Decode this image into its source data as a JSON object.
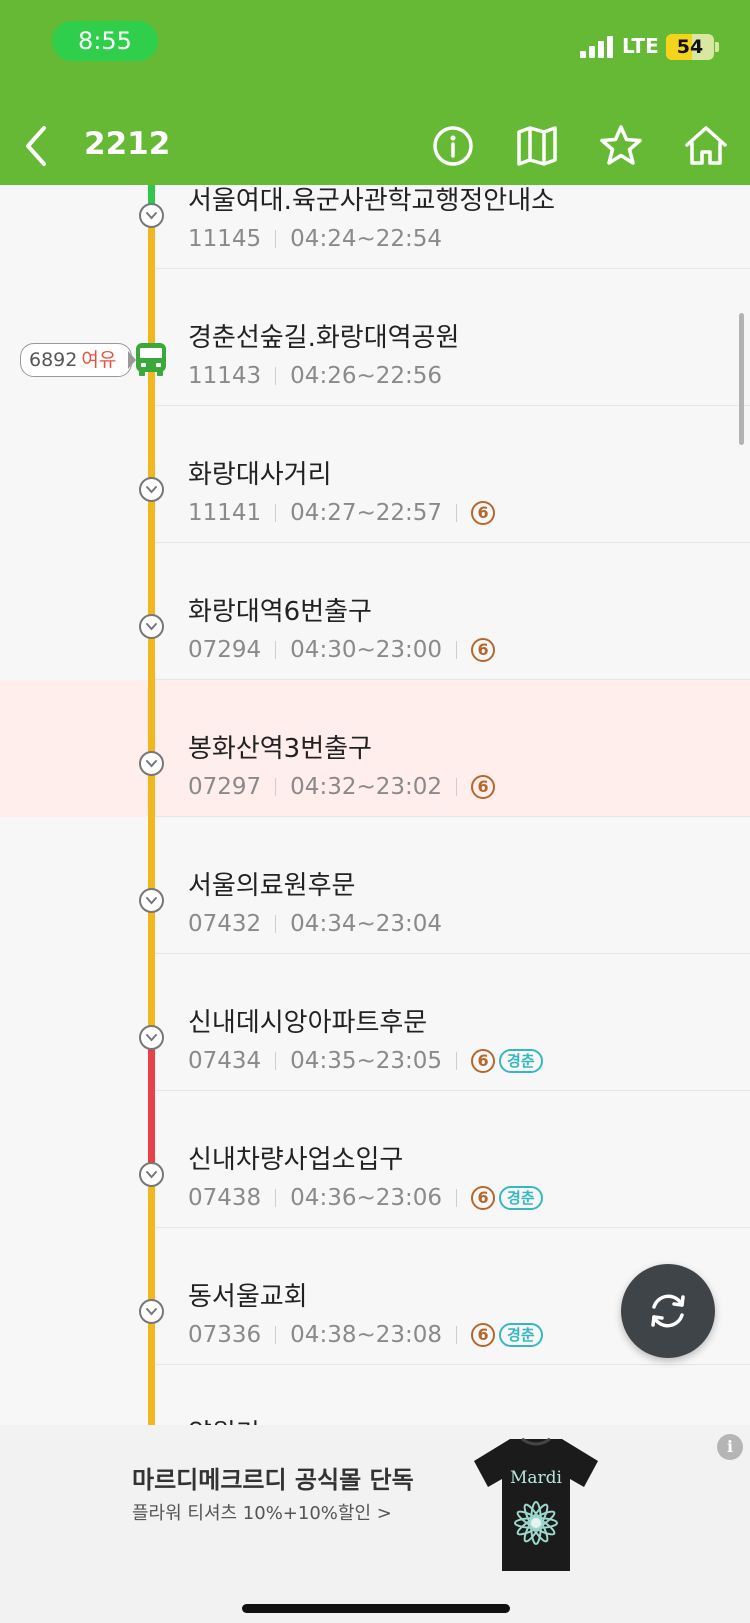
{
  "status_bar": {
    "time": "8:55",
    "network": "LTE",
    "battery": "54",
    "battery_level": 0.54
  },
  "header": {
    "route_number": "2212"
  },
  "bus": {
    "plate": "6892",
    "congestion": "여유"
  },
  "stops": [
    {
      "name": "서울여대.육군사관학교행정안내소",
      "id": "11145",
      "hours": "04:24~22:54",
      "subway": null,
      "gyeongchun": false,
      "highlight": false
    },
    {
      "name": "경춘선숲길.화랑대역공원",
      "id": "11143",
      "hours": "04:26~22:56",
      "subway": null,
      "gyeongchun": false,
      "highlight": false
    },
    {
      "name": "화랑대사거리",
      "id": "11141",
      "hours": "04:27~22:57",
      "subway": "6",
      "gyeongchun": false,
      "highlight": false
    },
    {
      "name": "화랑대역6번출구",
      "id": "07294",
      "hours": "04:30~23:00",
      "subway": "6",
      "gyeongchun": false,
      "highlight": false
    },
    {
      "name": "봉화산역3번출구",
      "id": "07297",
      "hours": "04:32~23:02",
      "subway": "6",
      "gyeongchun": false,
      "highlight": true
    },
    {
      "name": "서울의료원후문",
      "id": "07432",
      "hours": "04:34~23:04",
      "subway": null,
      "gyeongchun": false,
      "highlight": false
    },
    {
      "name": "신내데시앙아파트후문",
      "id": "07434",
      "hours": "04:35~23:05",
      "subway": "6",
      "gyeongchun": true,
      "highlight": false
    },
    {
      "name": "신내차량사업소입구",
      "id": "07438",
      "hours": "04:36~23:06",
      "subway": "6",
      "gyeongchun": true,
      "highlight": false
    },
    {
      "name": "동서울교회",
      "id": "07336",
      "hours": "04:38~23:08",
      "subway": "6",
      "gyeongchun": true,
      "highlight": false
    },
    {
      "name": "양원리",
      "id": "",
      "hours": "",
      "subway": null,
      "gyeongchun": false,
      "highlight": false
    }
  ],
  "gyeongchun_label": "경춘",
  "traffic_colors": {
    "smooth": "#2fc84a",
    "slow": "#f2b71f",
    "congested": "#e8414a"
  },
  "ad": {
    "title": "마르디메크르디 공식몰 단독",
    "subtitle": "플라워 티셔츠 10%+10%할인 >",
    "shirt_text": "Mardi",
    "info": "i"
  },
  "icons": {
    "back": "chevron-left-icon",
    "info": "info-icon",
    "map": "map-icon",
    "favorite": "star-icon",
    "home": "home-icon",
    "refresh": "refresh-icon"
  }
}
